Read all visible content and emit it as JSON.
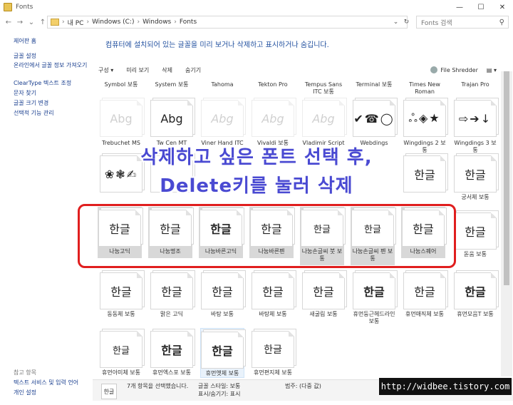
{
  "window": {
    "title": "Fonts",
    "minimize": "—",
    "maximize": "☐",
    "close": "✕"
  },
  "nav": {
    "back": "←",
    "forward": "→",
    "dropdown": "⌄",
    "up": "↑",
    "breadcrumbs": [
      "내 PC",
      "Windows (C:)",
      "Windows",
      "Fonts"
    ],
    "refresh": "↻",
    "search_placeholder": "Fonts 검색"
  },
  "sidebar": {
    "links": [
      "제어판 홈",
      "글꼴 설정",
      "온라인에서 글꼴 정보 가져오기",
      "ClearType 텍스트 조정",
      "문자 찾기",
      "글꼴 크기 변경",
      "선택적 기능 관리"
    ],
    "see_also_heading": "참고 항목",
    "see_also": [
      "텍스트 서비스 및 입력 언어",
      "개인 설정"
    ]
  },
  "main": {
    "instruction": "컴퓨터에 설치되어 있는 글꼴을 미리 보거나 삭제하고 표시하거나 숨깁니다.",
    "toolbar": [
      "구성 ▾",
      "미리 보기",
      "삭제",
      "숨기기"
    ],
    "file_shredder": "File Shredder"
  },
  "rows": {
    "top_labels": [
      "Symbol 보통",
      "System 보통",
      "Tahoma",
      "Tekton Pro",
      "Tempus Sans ITC 보통",
      "Terminal 보통",
      "Times New Roman",
      "Trajan Pro"
    ],
    "row1_samples": [
      "Abg",
      "Abg",
      "Abg",
      "Abg",
      "Abg",
      "✔☎◯",
      "ஃ◈★",
      "⇨➔↓"
    ],
    "row2_labels": [
      "Trebuchet MS",
      "Tw Cen MT",
      "Viner Hand ITC",
      "Vivaldi 보통",
      "Vladimir Script",
      "Webdings",
      "Wingdings 2 보통",
      "Wingdings 3 보통"
    ],
    "row2_samples": [
      "❀❃✍",
      "",
      "",
      "",
      "",
      "",
      "한글",
      "한글"
    ],
    "row2_last_label": "궁서체 보통",
    "selected": [
      {
        "sample": "한글",
        "label": "나눔고딕"
      },
      {
        "sample": "한글",
        "label": "나눔명조"
      },
      {
        "sample": "한글",
        "label": "나눔바른고딕"
      },
      {
        "sample": "한글",
        "label": "나눔바른펜"
      },
      {
        "sample": "한글",
        "label": "나눔손글씨 붓 보통"
      },
      {
        "sample": "한글",
        "label": "나눔손글씨 펜 보통"
      },
      {
        "sample": "한글",
        "label": "나눔스퀘어"
      }
    ],
    "row3_last": {
      "sample": "한글",
      "label": "돋움 보통"
    },
    "row4": [
      {
        "sample": "한글",
        "label": "동동체 보통"
      },
      {
        "sample": "한글",
        "label": "맑은 고딕"
      },
      {
        "sample": "한글",
        "label": "바탕 보통"
      },
      {
        "sample": "한글",
        "label": "바탕체 보통"
      },
      {
        "sample": "한글",
        "label": "새굴림 보통"
      },
      {
        "sample": "한글",
        "label": "휴먼둥근헤드라인 보통"
      },
      {
        "sample": "한글",
        "label": "휴먼매직체 보통"
      },
      {
        "sample": "한글",
        "label": "휴먼모음T 보통"
      }
    ],
    "row5": [
      {
        "sample": "한글",
        "label": "휴먼아미체 보통"
      },
      {
        "sample": "한글",
        "label": "휴먼엑스포 보통"
      },
      {
        "sample": "한글",
        "label": "휴먼옛체 보통"
      },
      {
        "sample": "한글",
        "label": "휴먼편지체 보통"
      }
    ]
  },
  "annotation": {
    "line1": "삭제하고 싶은 폰트 선택 후,",
    "line2": "Delete키를 눌러 삭제"
  },
  "status": {
    "thumb": "한글",
    "selected_count": "7개 항목을 선택했습니다.",
    "font_style": "글꼴 스타일: 보통",
    "show_hide": "표시/숨기기: 표시",
    "category": "범주: (다중 값)"
  },
  "watermark": "http://widbee.tistory.com"
}
